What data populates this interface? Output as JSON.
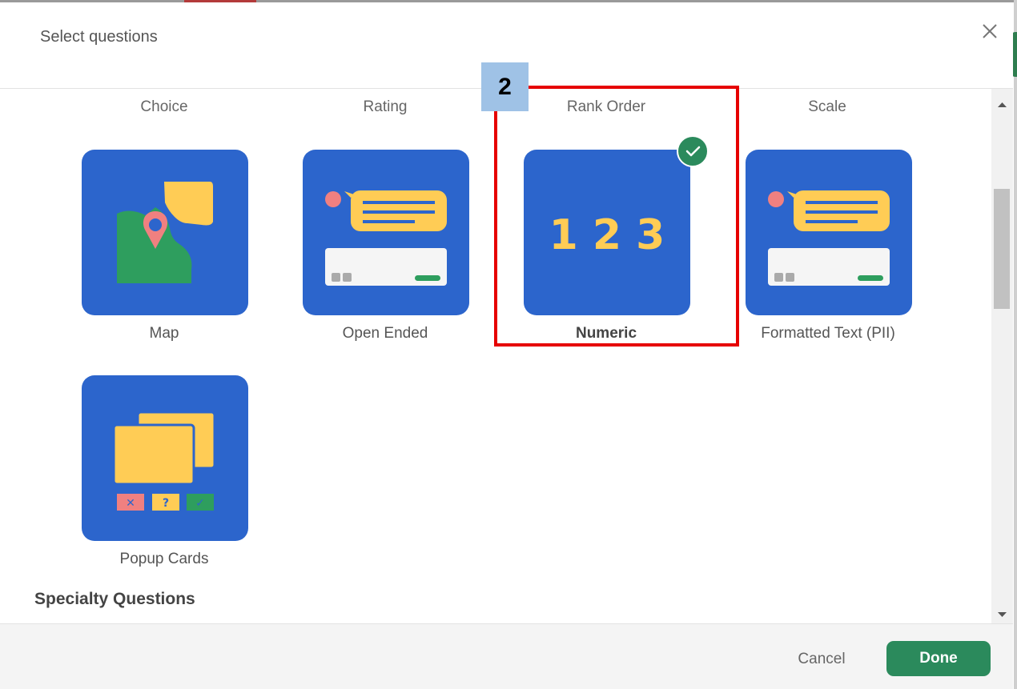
{
  "dialog": {
    "title": "Select questions"
  },
  "categories": [
    "Choice",
    "Rating",
    "Rank Order",
    "Scale"
  ],
  "tiles": [
    {
      "label": "Map",
      "icon": "map-icon",
      "selected": false
    },
    {
      "label": "Open Ended",
      "icon": "open-ended-icon",
      "selected": false
    },
    {
      "label": "Numeric",
      "icon": "numeric-icon",
      "selected": true,
      "digits": "1 2 3"
    },
    {
      "label": "Formatted Text (PII)",
      "icon": "formatted-text-icon",
      "selected": false
    },
    {
      "label": "Popup Cards",
      "icon": "popup-cards-icon",
      "selected": false
    }
  ],
  "section": {
    "title": "Specialty Questions"
  },
  "footer": {
    "cancel_label": "Cancel",
    "done_label": "Done"
  },
  "annotation": {
    "step_number": "2"
  },
  "colors": {
    "tile_bg": "#2c65cc",
    "accent_green": "#2b8a5c",
    "highlight_red": "#e60000",
    "yellow": "#ffcc55",
    "pink": "#f08080"
  }
}
